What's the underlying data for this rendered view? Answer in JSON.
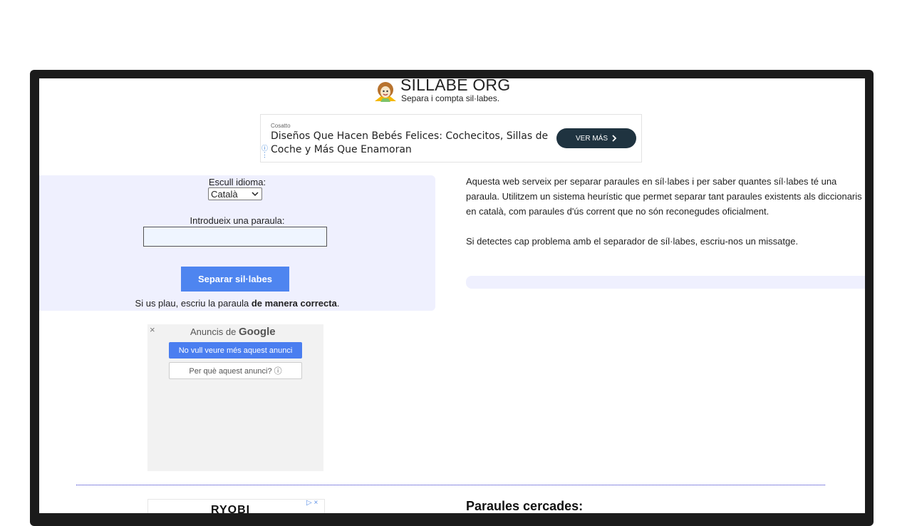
{
  "header": {
    "title": "SILLABE ORG",
    "subtitle": "Separa i compta sil·labes."
  },
  "top_ad": {
    "sponsor": "Cosatto",
    "headline": "Diseños Que Hacen Bebés Felices: Cochecitos, Sillas de Coche y Más Que Enamoran",
    "cta": "VER MÁS",
    "cta_icon": "chevron-right-icon",
    "info_icon": "ⓘ"
  },
  "form": {
    "language_label": "Escull idioma:",
    "language_selected": "Català",
    "word_label": "Introdueix una paraula:",
    "word_value": "",
    "submit_label": "Separar sil·labes",
    "hint_prefix": "Si us plau, escriu la paraula ",
    "hint_bold": "de manera correcta",
    "hint_suffix": "."
  },
  "description": {
    "paragraph1": "Aquesta web serveix per separar paraules en síl·labes i per saber quantes síl·labes té una paraula. Utilitzem un sistema heurístic que permet separar tant paraules existents als diccionaris en català, com paraules d'ús corrent que no són reconegudes oficialment.",
    "paragraph2": "Si detectes cap problema amb el separador de síl·labes, escriu-nos un missatge."
  },
  "google_ad": {
    "close": "×",
    "ads_by": "Anuncis de ",
    "brand": "Google",
    "stop_label": "No vull veure més aquest anunci",
    "why_label": "Per què aquest anunci? ⓘ"
  },
  "bottom_ad": {
    "brand": "RYOBI",
    "ad_choices": "▷ ×"
  },
  "searched": {
    "heading": "Paraules cercades:"
  },
  "colors": {
    "panel_bg": "#eff0fe",
    "primary_button": "#4e85f0",
    "frame": "#1b1b1b"
  }
}
